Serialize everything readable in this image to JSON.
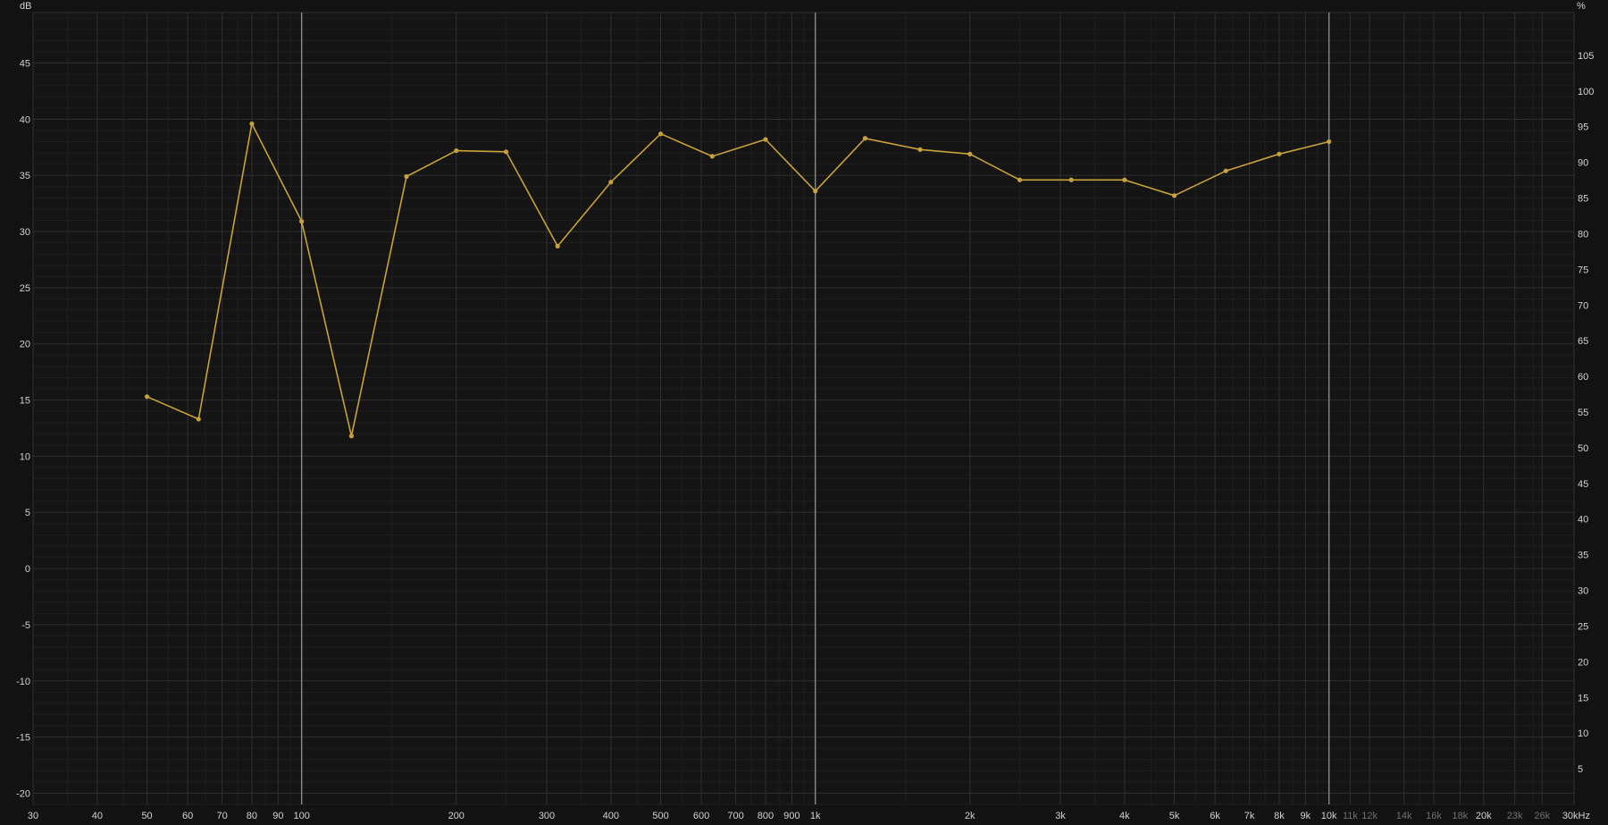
{
  "chart_data": {
    "type": "line",
    "title": "",
    "x_scale": "log",
    "y_scale": "linear",
    "xlim": [
      30,
      30000
    ],
    "ylim": [
      -21,
      49.5
    ],
    "y2lim": [
      0,
      111
    ],
    "y_unit": "dB",
    "y2_unit": "%",
    "x_unit": "kHz",
    "grid": true,
    "legend": "none",
    "colors": {
      "background": "#121212",
      "plot_background": "#141414",
      "grid_major": "#2f2f2f",
      "grid_minor": "#1f1f1f",
      "decade_line": "#8a8a8a",
      "series": "#c8a13a",
      "tick_text": "#d2d2d2",
      "tick_text_dim": "#6f6f6f"
    },
    "x_ticks": [
      {
        "value": 30,
        "label": "30"
      },
      {
        "value": 40,
        "label": "40"
      },
      {
        "value": 50,
        "label": "50"
      },
      {
        "value": 60,
        "label": "60"
      },
      {
        "value": 70,
        "label": "70"
      },
      {
        "value": 80,
        "label": "80"
      },
      {
        "value": 90,
        "label": "90"
      },
      {
        "value": 100,
        "label": "100"
      },
      {
        "value": 200,
        "label": "200"
      },
      {
        "value": 300,
        "label": "300"
      },
      {
        "value": 400,
        "label": "400"
      },
      {
        "value": 500,
        "label": "500"
      },
      {
        "value": 600,
        "label": "600"
      },
      {
        "value": 700,
        "label": "700"
      },
      {
        "value": 800,
        "label": "800"
      },
      {
        "value": 900,
        "label": "900"
      },
      {
        "value": 1000,
        "label": "1k"
      },
      {
        "value": 2000,
        "label": "2k"
      },
      {
        "value": 3000,
        "label": "3k"
      },
      {
        "value": 4000,
        "label": "4k"
      },
      {
        "value": 5000,
        "label": "5k"
      },
      {
        "value": 6000,
        "label": "6k"
      },
      {
        "value": 7000,
        "label": "7k"
      },
      {
        "value": 8000,
        "label": "8k"
      },
      {
        "value": 9000,
        "label": "9k"
      },
      {
        "value": 10000,
        "label": "10k"
      },
      {
        "value": 11000,
        "label": "11k",
        "dim": true
      },
      {
        "value": 12000,
        "label": "12k",
        "dim": true
      },
      {
        "value": 14000,
        "label": "14k",
        "dim": true
      },
      {
        "value": 16000,
        "label": "16k",
        "dim": true
      },
      {
        "value": 18000,
        "label": "18k",
        "dim": true
      },
      {
        "value": 20000,
        "label": "20k"
      },
      {
        "value": 23000,
        "label": "23k",
        "dim": true
      },
      {
        "value": 26000,
        "label": "26k",
        "dim": true
      },
      {
        "value": 30000,
        "label": "30kHz"
      }
    ],
    "y_ticks": [
      -20,
      -15,
      -10,
      -5,
      0,
      5,
      10,
      15,
      20,
      25,
      30,
      35,
      40,
      45
    ],
    "y_tick_labels": [
      "-20",
      "-15",
      "-10",
      "-5",
      "0",
      "5",
      "10",
      "15",
      "20",
      "25",
      "30",
      "35",
      "40",
      "45"
    ],
    "y2_ticks": [
      5,
      10,
      15,
      20,
      25,
      30,
      35,
      40,
      45,
      50,
      55,
      60,
      65,
      70,
      75,
      80,
      85,
      90,
      95,
      100,
      105
    ],
    "y2_tick_labels": [
      "5",
      "10",
      "15",
      "20",
      "25",
      "30",
      "35",
      "40",
      "45",
      "50",
      "55",
      "60",
      "65",
      "70",
      "75",
      "80",
      "85",
      "90",
      "95",
      "100",
      "105"
    ],
    "series": [
      {
        "x": [
          50,
          63,
          80,
          100,
          125,
          160,
          200,
          250,
          315,
          400,
          500,
          630,
          800,
          1000,
          1250,
          1600,
          2000,
          2500,
          3150,
          4000,
          5000,
          6300,
          8000,
          10000
        ],
        "y": [
          15.3,
          13.3,
          39.6,
          30.9,
          11.8,
          34.9,
          37.2,
          37.1,
          28.7,
          34.4,
          38.7,
          36.7,
          38.2,
          33.6,
          38.3,
          37.3,
          36.9,
          34.6,
          34.6,
          34.6,
          33.2,
          35.4,
          36.9,
          38.0
        ]
      }
    ]
  }
}
